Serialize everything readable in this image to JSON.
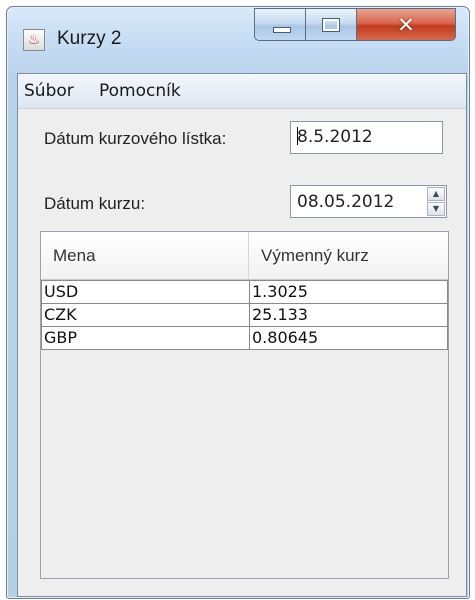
{
  "window": {
    "title": "Kurzy 2",
    "app_icon": "java-cup-icon",
    "caption_buttons": {
      "minimize": "minimize-icon",
      "maximize": "maximize-icon",
      "close": "✕"
    }
  },
  "menu": {
    "items": [
      {
        "label": "Súbor"
      },
      {
        "label": "Pomocník"
      }
    ]
  },
  "form": {
    "list_date_label": "Dátum kurzového lístka:",
    "list_date_value": "8.5.2012",
    "rate_date_label": "Dátum kurzu:",
    "rate_date_value": "08.05.2012"
  },
  "table": {
    "columns": [
      "Mena",
      "Výmenný kurz"
    ],
    "rows": [
      {
        "currency": "USD",
        "rate": "1.3025"
      },
      {
        "currency": "CZK",
        "rate": "25.133"
      },
      {
        "currency": "GBP",
        "rate": "0.80645"
      }
    ]
  },
  "colors": {
    "frame_accent": "#b9d2ec",
    "close_button": "#c13a1f"
  }
}
